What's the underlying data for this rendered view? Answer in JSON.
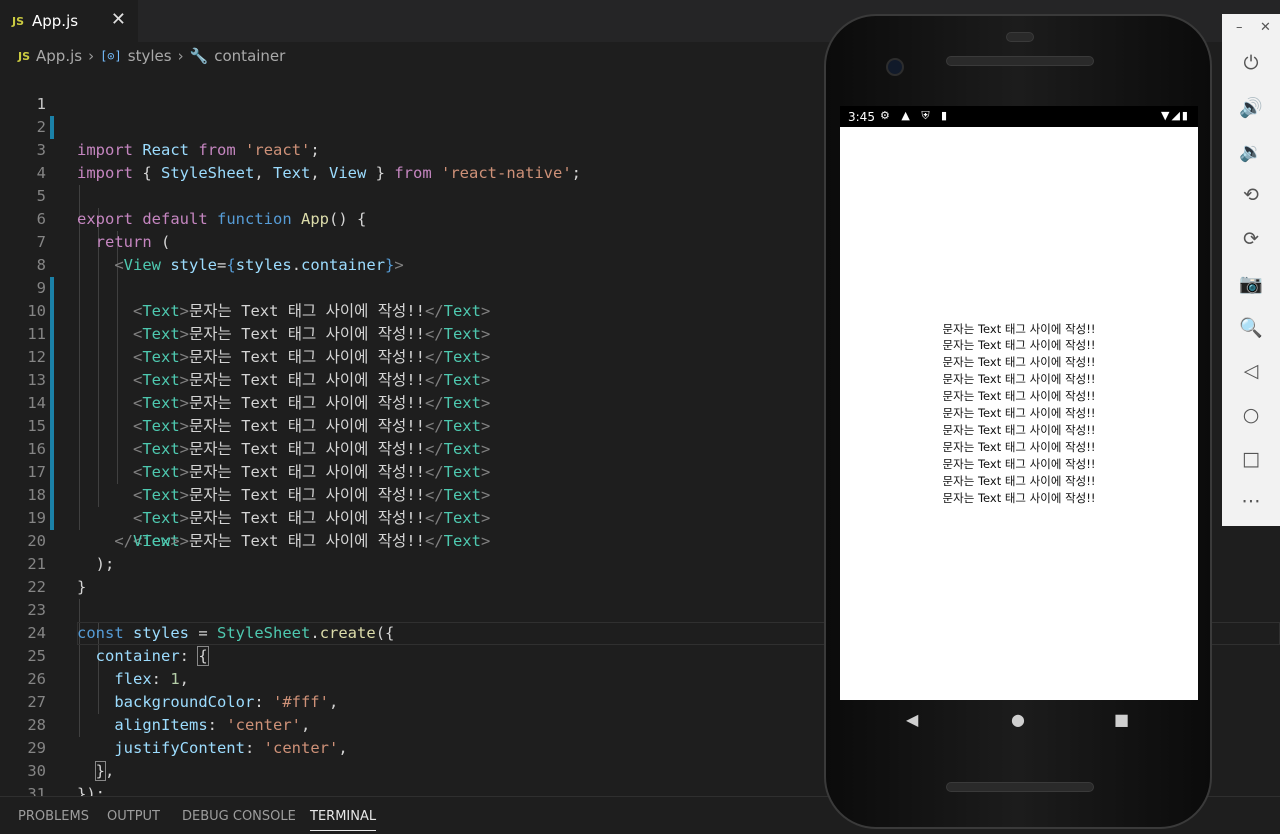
{
  "tab": {
    "badge": "JS",
    "title": "App.js",
    "close": "✕"
  },
  "breadcrumb": {
    "file": "App.js",
    "styles": "styles",
    "container": "container"
  },
  "editor": {
    "active_line": "1",
    "lines": [
      {
        "n": "1"
      },
      {
        "n": "2"
      },
      {
        "n": "3"
      },
      {
        "n": "4"
      },
      {
        "n": "5"
      },
      {
        "n": "6"
      },
      {
        "n": "7"
      },
      {
        "n": "8"
      },
      {
        "n": "9"
      },
      {
        "n": "10"
      },
      {
        "n": "11"
      },
      {
        "n": "12"
      },
      {
        "n": "13"
      },
      {
        "n": "14"
      },
      {
        "n": "15"
      },
      {
        "n": "16"
      },
      {
        "n": "17"
      },
      {
        "n": "18"
      },
      {
        "n": "19"
      },
      {
        "n": "20"
      },
      {
        "n": "21"
      },
      {
        "n": "22"
      },
      {
        "n": "23"
      },
      {
        "n": "24"
      },
      {
        "n": "25"
      },
      {
        "n": "26"
      },
      {
        "n": "27"
      },
      {
        "n": "28"
      },
      {
        "n": "29"
      },
      {
        "n": "30"
      },
      {
        "n": "31"
      }
    ],
    "text_element_line": "문자는 Text 태그 사이에 작성!!",
    "style_values": {
      "flex": "1",
      "backgroundColor": "'#fff'",
      "alignItems": "'center'",
      "justifyContent": "'center'"
    }
  },
  "panel": {
    "tabs": [
      "PROBLEMS",
      "OUTPUT",
      "DEBUG CONSOLE",
      "TERMINAL"
    ],
    "active": "TERMINAL"
  },
  "phone": {
    "time": "3:45",
    "messages": [
      "문자는 Text 태그 사이에 작성!!",
      "문자는 Text 태그 사이에 작성!!",
      "문자는 Text 태그 사이에 작성!!",
      "문자는 Text 태그 사이에 작성!!",
      "문자는 Text 태그 사이에 작성!!",
      "문자는 Text 태그 사이에 작성!!",
      "문자는 Text 태그 사이에 작성!!",
      "문자는 Text 태그 사이에 작성!!",
      "문자는 Text 태그 사이에 작성!!",
      "문자는 Text 태그 사이에 작성!!",
      "문자는 Text 태그 사이에 작성!!"
    ]
  },
  "emulator_toolbar": {
    "minimize": "–",
    "close": "✕",
    "buttons": [
      "power-icon",
      "volume-up-icon",
      "volume-down-icon",
      "rotate-left-icon",
      "rotate-right-icon",
      "camera-icon",
      "zoom-icon",
      "back-icon",
      "home-icon",
      "overview-icon",
      "more-icon"
    ]
  },
  "colors": {
    "keyword": "#c586c0",
    "string": "#ce9178",
    "storage": "#569cd6",
    "variable": "#9cdcfe",
    "function": "#dcdcaa",
    "type": "#4ec9b0",
    "number": "#b5cea8",
    "git_mark": "#1b81a8"
  }
}
